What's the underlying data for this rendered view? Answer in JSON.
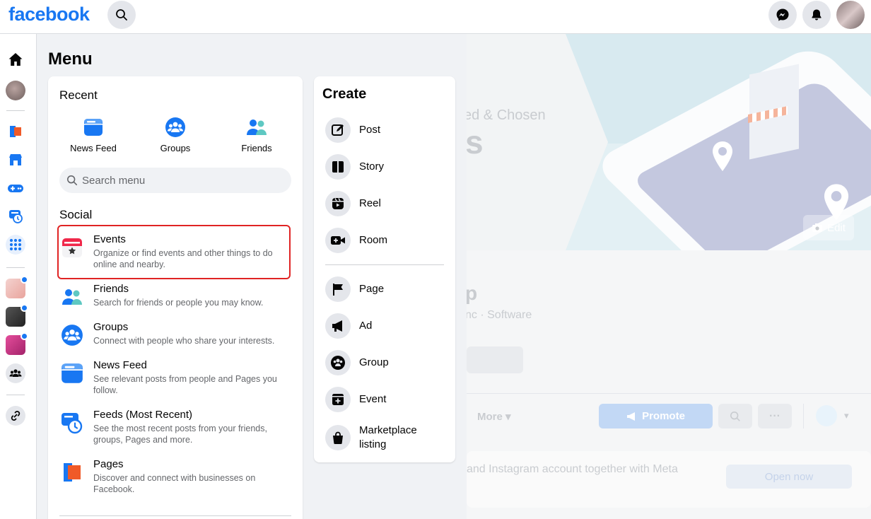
{
  "topbar": {
    "logo": "facebook"
  },
  "background_page": {
    "cover_text_1": "ed & Chosen",
    "cover_text_2": "s",
    "edit_label": "Edit",
    "name_fragment": "p",
    "category": "nc · Software",
    "more_label": "More",
    "promote_label": "Promote",
    "banner_text": "and Instagram account together with Meta",
    "open_now_label": "Open now"
  },
  "menu": {
    "title": "Menu",
    "recent": {
      "title": "Recent",
      "items": [
        {
          "label": "News Feed",
          "icon": "news-feed-icon"
        },
        {
          "label": "Groups",
          "icon": "groups-icon"
        },
        {
          "label": "Friends",
          "icon": "friends-icon"
        }
      ]
    },
    "search": {
      "placeholder": "Search menu"
    },
    "social": {
      "title": "Social",
      "items": [
        {
          "name": "Events",
          "desc": "Organize or find events and other things to do online and nearby.",
          "icon": "events-icon"
        },
        {
          "name": "Friends",
          "desc": "Search for friends or people you may know.",
          "icon": "friends-icon"
        },
        {
          "name": "Groups",
          "desc": "Connect with people who share your interests.",
          "icon": "groups-icon"
        },
        {
          "name": "News Feed",
          "desc": "See relevant posts from people and Pages you follow.",
          "icon": "news-feed-icon"
        },
        {
          "name": "Feeds (Most Recent)",
          "desc": "See the most recent posts from your friends, groups, Pages and more.",
          "icon": "feeds-recent-icon"
        },
        {
          "name": "Pages",
          "desc": "Discover and connect with businesses on Facebook.",
          "icon": "pages-icon"
        }
      ]
    },
    "create": {
      "title": "Create",
      "items": [
        {
          "label": "Post",
          "icon": "post-icon"
        },
        {
          "label": "Story",
          "icon": "story-icon"
        },
        {
          "label": "Reel",
          "icon": "reel-icon"
        },
        {
          "label": "Room",
          "icon": "room-icon"
        },
        {
          "label": "Page",
          "icon": "page-flag-icon"
        },
        {
          "label": "Ad",
          "icon": "megaphone-icon"
        },
        {
          "label": "Group",
          "icon": "group-icon"
        },
        {
          "label": "Event",
          "icon": "event-plus-icon"
        },
        {
          "label": "Marketplace listing",
          "icon": "shopping-bag-icon"
        }
      ]
    }
  },
  "colors": {
    "brand": "#1877f2",
    "highlight": "#e02424",
    "secondary_text": "#65676b"
  }
}
